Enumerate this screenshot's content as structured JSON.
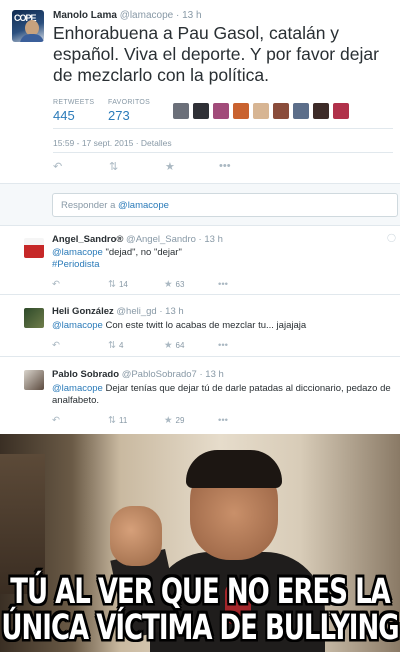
{
  "tweet": {
    "name": "Manolo Lama",
    "handle": "@lamacope",
    "time": "13 h",
    "text": "Enhorabuena a Pau Gasol, catalán y español. Viva el deporte. Y por favor dejar de mezclarlo con la política.",
    "retweets_label": "RETWEETS",
    "retweets": "445",
    "favorites_label": "FAVORITOS",
    "favorites": "273",
    "datetime": "15:59 - 17 sept. 2015 · Detalles",
    "reply_icon": "reply-arrow",
    "retweet_icon": "retweet-arrows",
    "favorite_icon": "star",
    "more_icon": "ellipsis"
  },
  "reply_box": {
    "prefix": "Responder a ",
    "mention": "@lamacope"
  },
  "replies": [
    {
      "name": "Angel_Sandro®",
      "handle": "@Angel_Sandro",
      "time": "13 h",
      "mention": "@lamacope",
      "text": " \"dejad\", no \"dejar\"",
      "hashtag": "#Periodista",
      "retweets": "14",
      "favorites": "63"
    },
    {
      "name": "Heli González",
      "handle": "@heli_gd",
      "time": "13 h",
      "mention": "@lamacope",
      "text": " Con este twitt lo acabas de mezclar tu... jajajaja",
      "retweets": "4",
      "favorites": "64"
    },
    {
      "name": "Pablo Sobrado",
      "handle": "@PabloSobrado7",
      "time": "13 h",
      "mention": "@lamacope",
      "text": " Dejar tenías que dejar tú de darle patadas al diccionario, pedazo de analfabeto.",
      "retweets": "11",
      "favorites": "29"
    }
  ],
  "meme": {
    "line1": "TÚ AL VER QUE NO ERES LA",
    "line2": "ÚNICA VÍCTIMA DE BULLYING"
  },
  "colors": {
    "link": "#2b7bb9",
    "muted": "#8899a6",
    "border": "#e1e8ed"
  }
}
